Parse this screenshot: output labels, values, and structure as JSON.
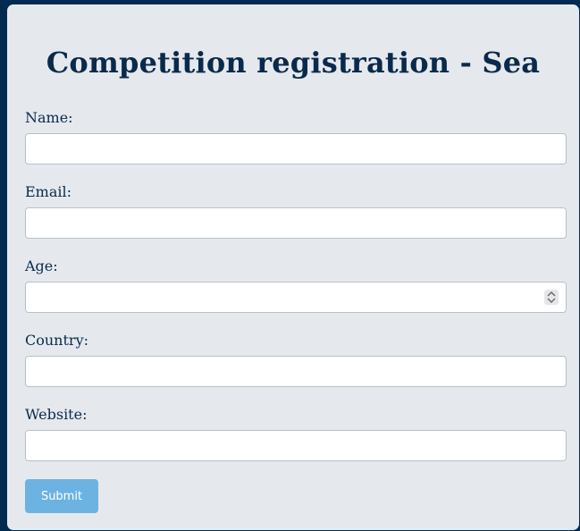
{
  "form": {
    "title": "Competition registration - Sea",
    "fields": [
      {
        "label": "Name:",
        "value": "",
        "placeholder": ""
      },
      {
        "label": "Email:",
        "value": "",
        "placeholder": ""
      },
      {
        "label": "Age:",
        "value": "",
        "placeholder": ""
      },
      {
        "label": "Country:",
        "value": "",
        "placeholder": ""
      },
      {
        "label": "Website:",
        "value": "",
        "placeholder": ""
      }
    ],
    "submit_label": "Submit"
  },
  "colors": {
    "page_background": "#002a4f",
    "card_background": "#e5e9ed",
    "title_text": "#0a2a4c",
    "submit_button": "#6cb3e1"
  },
  "icons": {
    "age_spinner": "spinner-up-down-icon"
  }
}
